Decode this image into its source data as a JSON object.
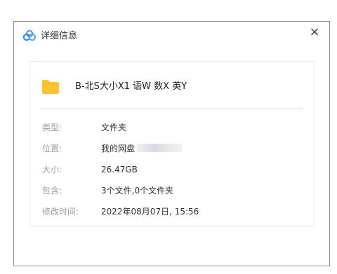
{
  "dialog": {
    "title": "详细信息",
    "close_label": "×"
  },
  "file": {
    "name": "B-北S大小X1 语W 数X 英Y",
    "icon": "folder-icon"
  },
  "details": [
    {
      "label": "类型:",
      "value": "文件夹"
    },
    {
      "label": "位置:",
      "value": "我的网盘"
    },
    {
      "label": "大小:",
      "value": "26.47GB"
    },
    {
      "label": "包含:",
      "value": "3个文件,0个文件夹"
    },
    {
      "label": "修改时间:",
      "value": "2022年08月07日, 15:56"
    }
  ],
  "colors": {
    "folder": "#ffc233",
    "brand": "#2f7cf6"
  }
}
